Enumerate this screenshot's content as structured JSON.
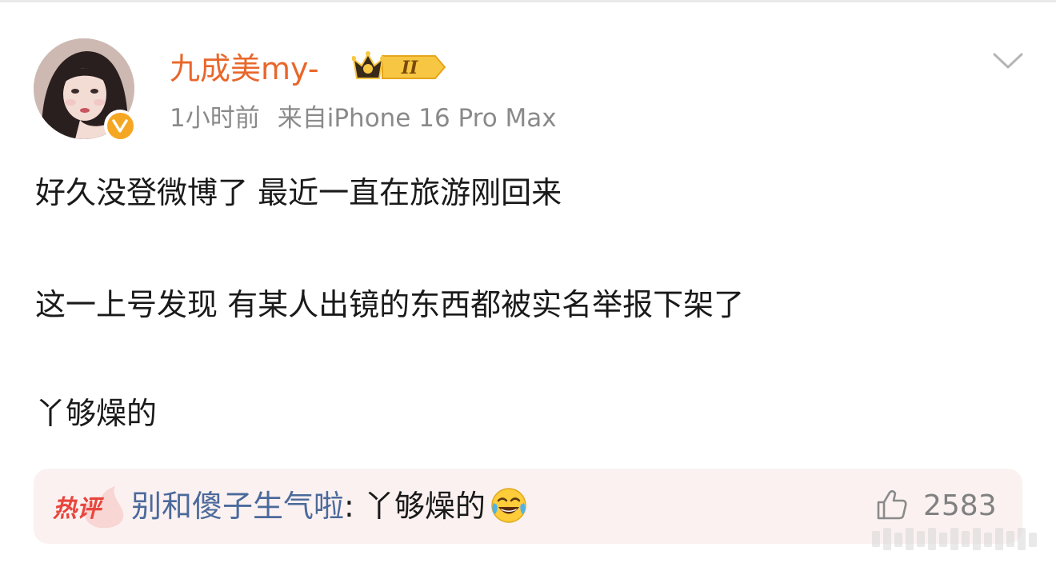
{
  "post": {
    "author": "九成美my-",
    "time": "1小时前",
    "source": "来自iPhone 16 Pro Max",
    "level_badge": "II",
    "lines": [
      "好久没登微博了 最近一直在旅游刚回来",
      "这一上号发现 有某人出镜的东西都被实名举报下架了",
      "丫够燥的"
    ]
  },
  "hot_comment": {
    "label": "热评",
    "author": "别和傻子生气啦",
    "separator": ": ",
    "text": "丫够燥的",
    "emoji_icon": "laughing-tears-emoji",
    "likes": "2583"
  },
  "icons": {
    "verified": "verified-v-icon",
    "menu": "chevron-down-icon",
    "like": "thumbs-up-icon",
    "crown": "crown-badge-icon"
  },
  "colors": {
    "author": "#e8672b",
    "meta": "#8a8a8a",
    "comment_author": "#4b6a9b",
    "hot_label": "#e8453c",
    "comment_bg": "#fbf1f1",
    "verified": "#f5a623"
  }
}
